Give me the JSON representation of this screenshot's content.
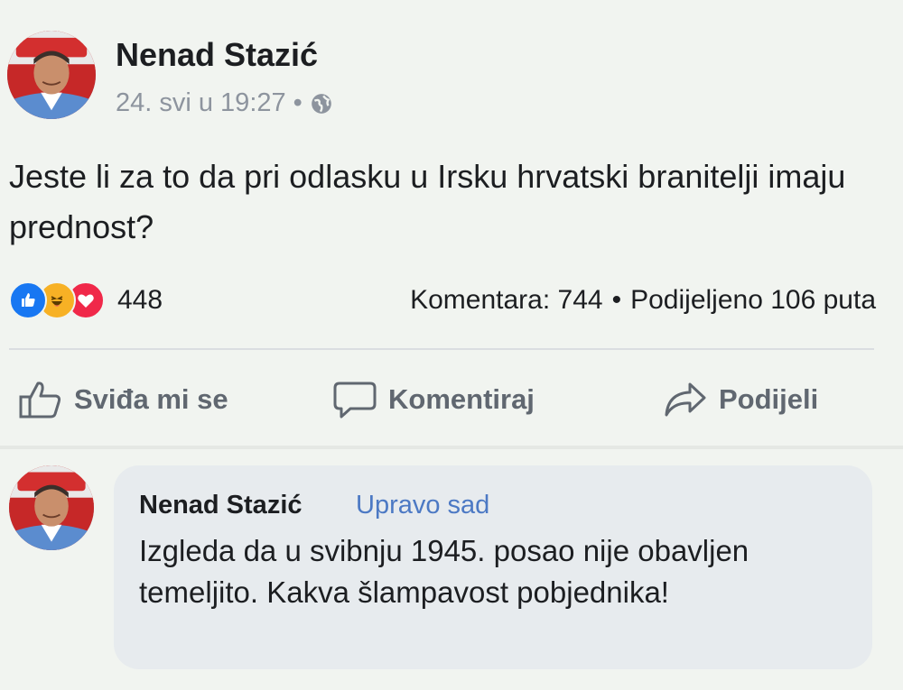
{
  "post": {
    "author": "Nenad Stazić",
    "timestamp": "24. svi u 19:27",
    "separator": "•",
    "privacy_icon": "globe-icon",
    "text": "Jeste li za to da pri odlasku u Irsku hrvatski branitelji imaju prednost?"
  },
  "reactions": {
    "icons": [
      "like-icon",
      "haha-icon",
      "love-icon"
    ],
    "count": "448"
  },
  "stats": {
    "comments": "Komentara: 744",
    "dot": "•",
    "shares": "Podijeljeno 106 puta"
  },
  "actions": {
    "like_label": "Sviđa mi se",
    "comment_label": "Komentiraj",
    "share_label": "Podijeli"
  },
  "comment": {
    "author": "Nenad Stazić",
    "time": "Upravo sad",
    "text": "Izgleda da u svibnju 1945. posao nije obavljen temeljito. Kakva šlampavost pobjednika!"
  },
  "colors": {
    "background": "#f1f4f0",
    "link_blue": "#4c79c4",
    "like_blue": "#1877f2",
    "love_red": "#f02849",
    "haha_yellow": "#f7b125",
    "muted_gray": "#606770"
  }
}
